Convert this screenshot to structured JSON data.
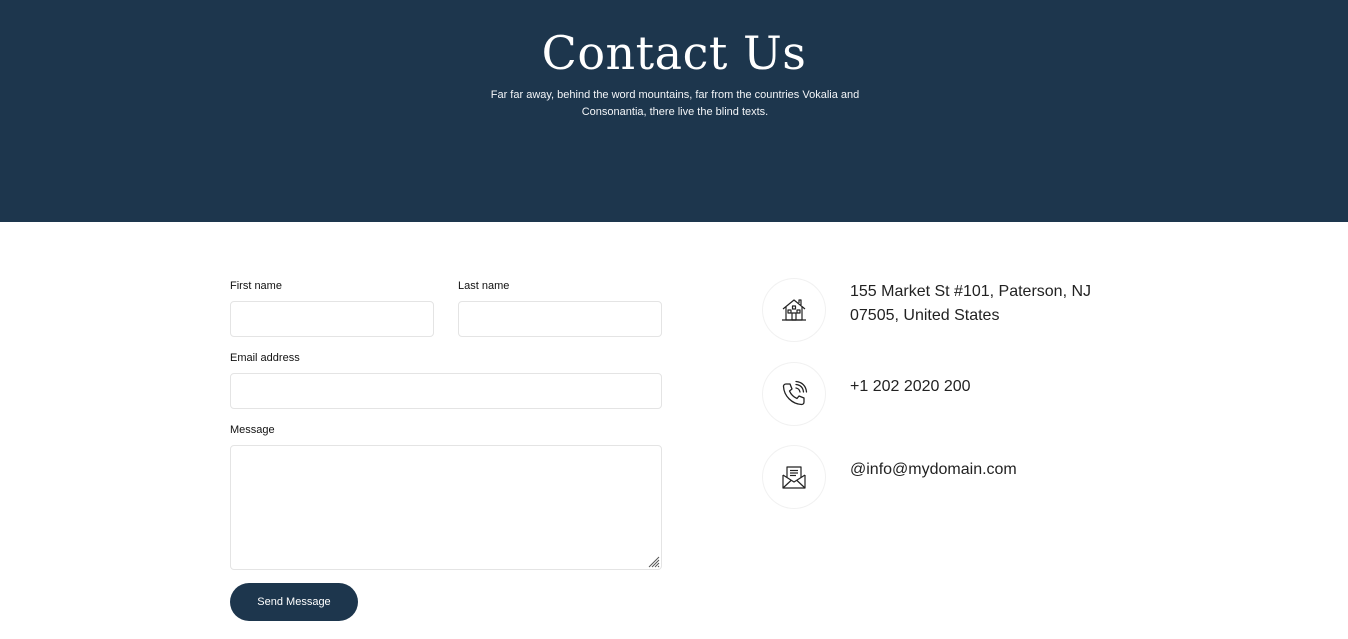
{
  "hero": {
    "title": "Contact Us",
    "subtitle": "Far far away, behind the word mountains, far from the countries Vokalia and Consonantia, there live the blind texts."
  },
  "form": {
    "first_name_label": "First name",
    "first_name_value": "",
    "last_name_label": "Last name",
    "last_name_value": "",
    "email_label": "Email address",
    "email_value": "",
    "message_label": "Message",
    "message_value": "",
    "submit_label": "Send Message"
  },
  "contact": {
    "address_icon": "house-icon",
    "address": "155 Market St #101, Paterson, NJ 07505, United States",
    "phone_icon": "phone-icon",
    "phone": "+1 202 2020 200",
    "email_icon": "envelope-icon",
    "email": "@info@mydomain.com"
  },
  "colors": {
    "hero_background": "#1d364d",
    "button_background": "#1d364d"
  }
}
